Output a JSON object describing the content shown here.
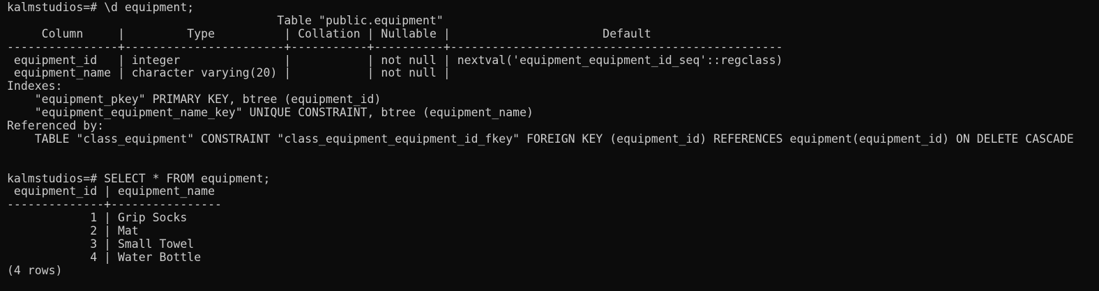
{
  "terminal": {
    "lines": [
      "kalmstudios=# \\d equipment;",
      "                                       Table \"public.equipment\"",
      "     Column     |         Type          | Collation | Nullable |                      Default",
      "----------------+-----------------------+-----------+----------+------------------------------------------------",
      " equipment_id   | integer               |           | not null | nextval('equipment_equipment_id_seq'::regclass)",
      " equipment_name | character varying(20) |           | not null |",
      "Indexes:",
      "    \"equipment_pkey\" PRIMARY KEY, btree (equipment_id)",
      "    \"equipment_equipment_name_key\" UNIQUE CONSTRAINT, btree (equipment_name)",
      "Referenced by:",
      "    TABLE \"class_equipment\" CONSTRAINT \"class_equipment_equipment_id_fkey\" FOREIGN KEY (equipment_id) REFERENCES equipment(equipment_id) ON DELETE CASCADE",
      "",
      "",
      "kalmstudios=# SELECT * FROM equipment;",
      " equipment_id | equipment_name",
      "--------------+----------------",
      "            1 | Grip Socks",
      "            2 | Mat",
      "            3 | Small Towel",
      "            4 | Water Bottle",
      "(4 rows)"
    ]
  }
}
